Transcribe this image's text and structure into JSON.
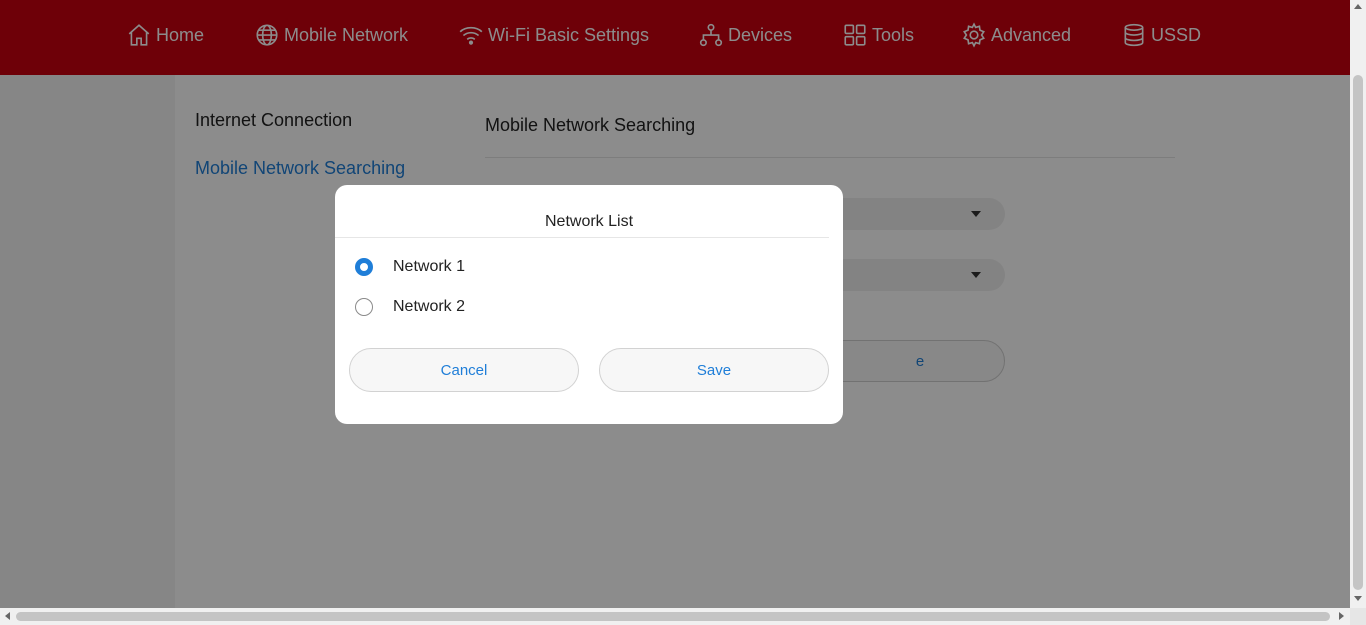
{
  "nav": {
    "items": [
      {
        "label": "Home",
        "icon": "home-icon"
      },
      {
        "label": "Mobile Network",
        "icon": "globe-icon",
        "active": true
      },
      {
        "label": "Wi-Fi Basic Settings",
        "icon": "wifi-icon"
      },
      {
        "label": "Devices",
        "icon": "devices-icon"
      },
      {
        "label": "Tools",
        "icon": "tools-icon"
      },
      {
        "label": "Advanced",
        "icon": "gear-icon"
      },
      {
        "label": "USSD",
        "icon": "database-icon"
      }
    ]
  },
  "sidebar": {
    "items": [
      {
        "label": "Internet Connection"
      },
      {
        "label": "Mobile Network Searching",
        "active": true
      }
    ]
  },
  "main": {
    "title": "Mobile Network Searching",
    "search_button_visible_text": "e"
  },
  "modal": {
    "title": "Network List",
    "options": [
      {
        "label": "Network 1",
        "checked": true
      },
      {
        "label": "Network 2",
        "checked": false
      }
    ],
    "cancel_label": "Cancel",
    "save_label": "Save"
  },
  "colors": {
    "header": "#c8000f",
    "accent": "#1f7ed8"
  }
}
